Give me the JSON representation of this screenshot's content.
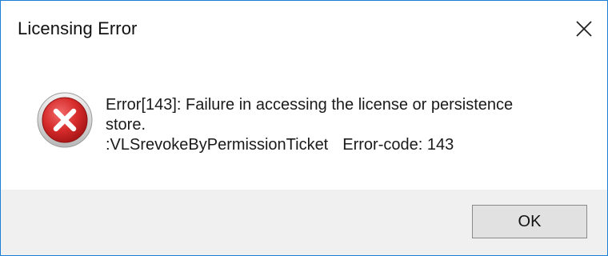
{
  "window": {
    "title": "Licensing Error",
    "close_icon": "close-icon",
    "border_color": "#1b7fd6"
  },
  "message": {
    "icon": "error-icon",
    "icon_color": "#d32f2f",
    "line1": "Error[143]: Failure in accessing the license or persistence",
    "line2": "store.",
    "line3_function": ":VLSrevokeByPermissionTicket",
    "line3_code": "Error-code: 143"
  },
  "footer": {
    "ok_label": "OK",
    "background": "#f0f0f0"
  }
}
